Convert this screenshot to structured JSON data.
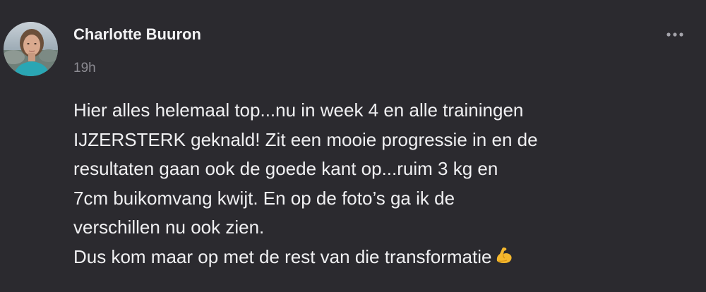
{
  "post": {
    "author": "Charlotte Buuron",
    "timestamp": "19h",
    "lines": [
      "Hier alles helemaal top...nu in week 4 en alle trainingen",
      "IJZERSTERK geknald! Zit een mooie progressie in en de",
      "resultaten gaan ook de goede kant op...ruim 3 kg en",
      "7cm buikomvang kwijt. En op de foto’s ga ik de",
      "verschillen nu ook zien.",
      "Dus kom maar op met de rest van die transformatie"
    ],
    "emoji": "flexed-biceps-emoji",
    "more_icon": "more-horizontal-icon",
    "avatar_icon": "profile-photo"
  },
  "colors": {
    "background": "#2b2a2f",
    "text": "#f0f0f2",
    "muted": "#8d8c93",
    "emoji": "#f5b82e"
  }
}
